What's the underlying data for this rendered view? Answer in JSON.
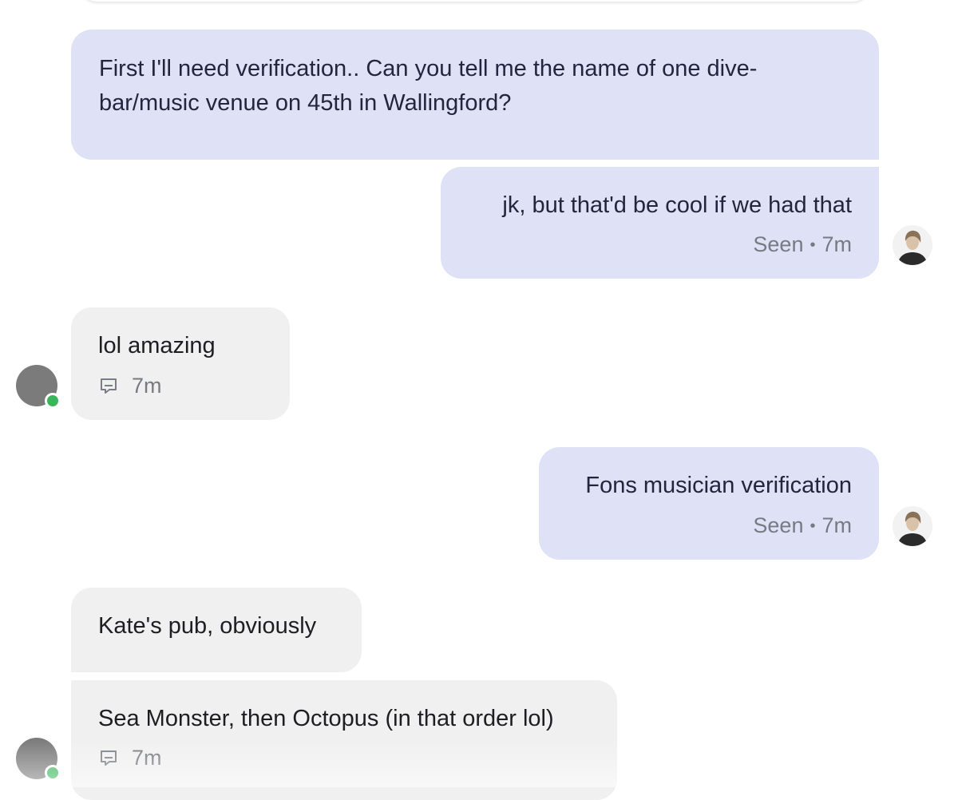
{
  "messages": [
    {
      "from": "them",
      "text": "First I'll need verification.. Can you tell me the name of one dive-bar/music venue on 45th in Wallingford?"
    },
    {
      "from": "me",
      "text": "jk, but that'd be cool if we had that",
      "status": "Seen",
      "sep": "•",
      "time": "7m"
    },
    {
      "from": "them",
      "text": "lol amazing",
      "time": "7m"
    },
    {
      "from": "me",
      "text": "Fons musician verification",
      "status": "Seen",
      "sep": "•",
      "time": "7m"
    },
    {
      "from": "them",
      "text": "Kate's pub, obviously"
    },
    {
      "from": "them",
      "text": "Sea Monster, then Octopus (in that order lol)",
      "time": "7m"
    }
  ],
  "icons": {
    "reply": "reply-icon",
    "my_avatar": "user-avatar",
    "their_avatar": "contact-avatar",
    "presence": "online-status"
  },
  "colors": {
    "sent_bubble": "#dfe2f6",
    "received_bubble": "#f0f0f1",
    "online": "#3ab65a",
    "avatar_gray": "#7b7b7b"
  }
}
